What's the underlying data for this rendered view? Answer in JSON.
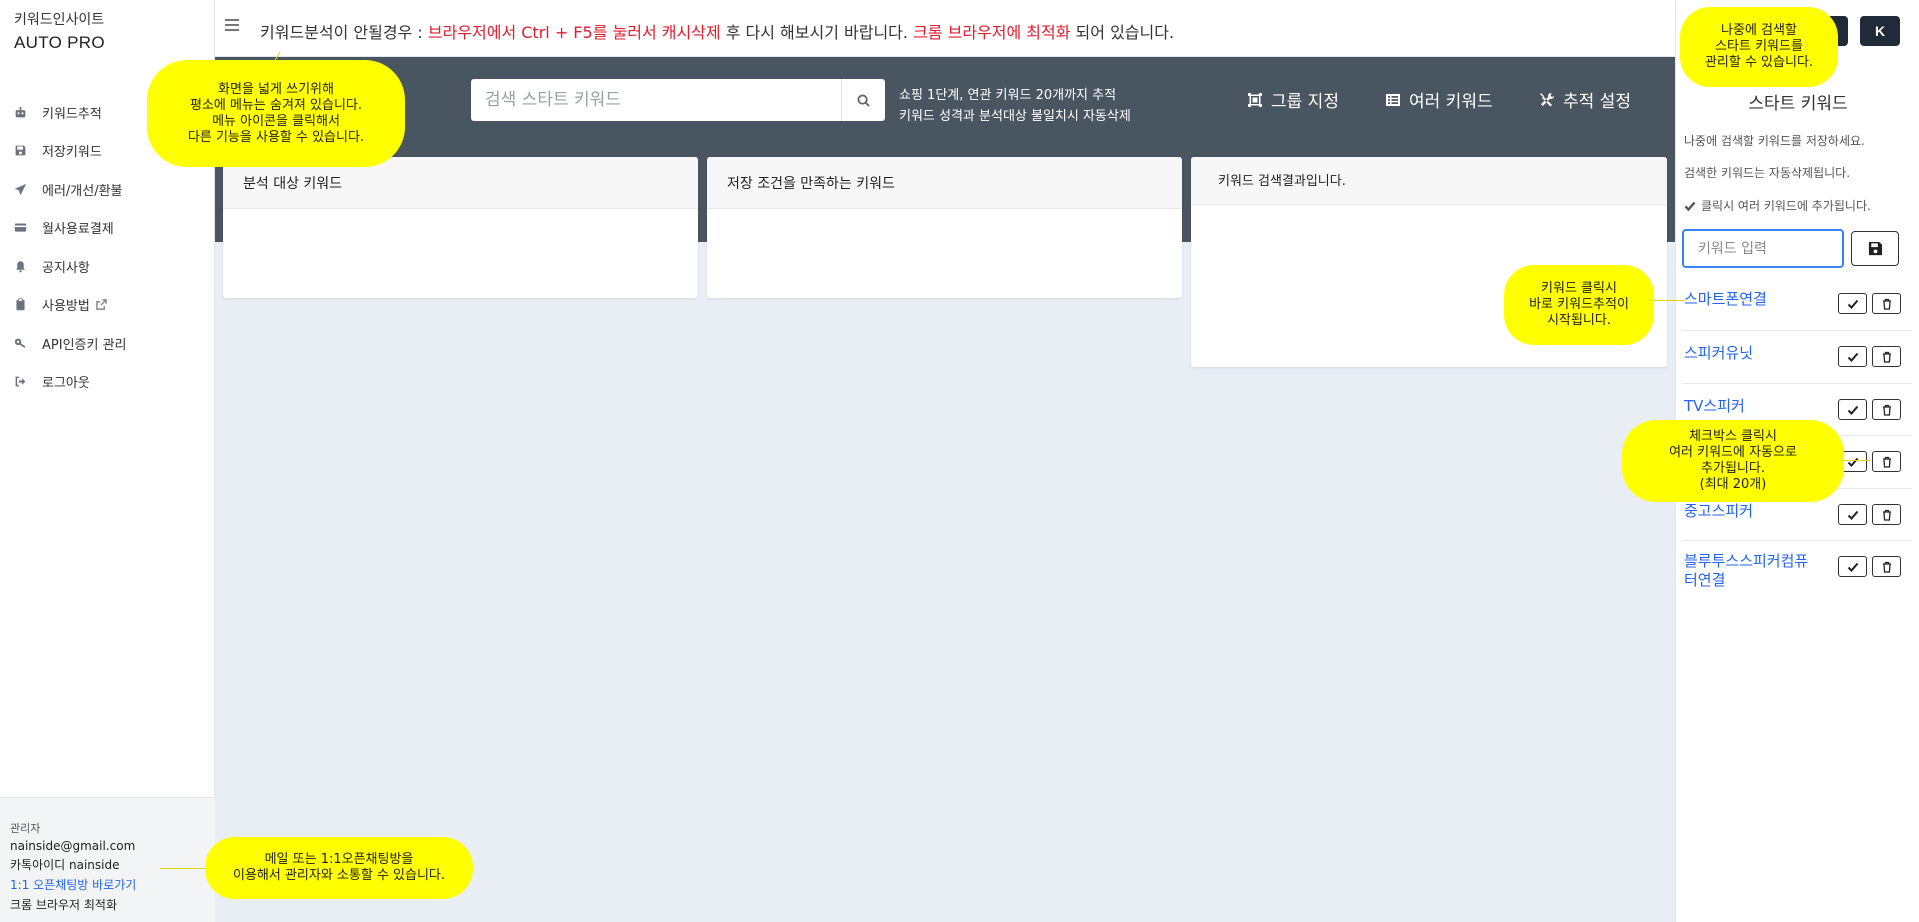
{
  "sidebar": {
    "brand_sub": "키워드인사이트",
    "brand_main": "AUTO PRO",
    "items": [
      {
        "label": "키워드추적",
        "icon": "robot-icon"
      },
      {
        "label": "저장키워드",
        "icon": "floppy-icon"
      },
      {
        "label": "에러/개선/환불",
        "icon": "paper-plane-icon"
      },
      {
        "label": "월사용료결제",
        "icon": "credit-card-icon"
      },
      {
        "label": "공지사항",
        "icon": "bell-icon"
      },
      {
        "label": "사용방법",
        "icon": "clipboard-icon"
      },
      {
        "label": "API인증키 관리",
        "icon": "key-icon"
      },
      {
        "label": "로그아웃",
        "icon": "logout-icon"
      }
    ],
    "footer": {
      "role": "관리자",
      "email": "nainside@gmail.com",
      "kakao": "카톡아이디 nainside",
      "chat_link": "1:1 오픈채팅방 바로가기",
      "browser": "크롬 브라우저 최적화"
    }
  },
  "topbar": {
    "notice_1": "키워드분석이 안될경우 : ",
    "notice_red_1": "브라우저에서 Ctrl + F5를 눌러서 캐시삭제",
    "notice_2": " 후 다시 해보시기 바랍니다. ",
    "notice_red_2": "크롬 브라우저에 최적화",
    "notice_3": " 되어 있습니다."
  },
  "band": {
    "search_placeholder": "검색 스타트 키워드",
    "info_line_1": "쇼핑 1단계, 연관 키워드 20개까지 추적",
    "info_line_2": "키워드 성격과 분석대상 불일치시 자동삭제",
    "btn_group": "그룹 지정",
    "btn_multi": "여러 키워드",
    "btn_settings": "추적 설정"
  },
  "cards": {
    "analysis": "분석 대상 키워드",
    "saved_condition": "저장 조건을 만족하는 키워드",
    "search_result": "키워드 검색결과입니다."
  },
  "right_panel": {
    "btn_k": "K",
    "title": "스타트 키워드",
    "desc_1": "나중에 검색할 키워드를 저장하세요.",
    "desc_2": "검색한 키워드는 자동삭제됩니다.",
    "desc_3": "클릭시 여러 키워드에 추가됩니다.",
    "input_placeholder": "키워드 입력",
    "keywords": [
      {
        "label": "스마트폰연결"
      },
      {
        "label": "스피커유닛"
      },
      {
        "label": "TV스피커"
      },
      {
        "label": ""
      },
      {
        "label": "중고스피커"
      },
      {
        "label": "블루투스스피커컴퓨터연결"
      }
    ]
  },
  "callouts": {
    "menu": [
      "화면을 넓게 쓰기위해",
      "평소에 메뉴는 숨겨져 있습니다.",
      "메뉴 아이콘을 클릭해서",
      "다른 기능을 사용할 수 있습니다."
    ],
    "start_keyword": [
      "나중에 검색할",
      "스타트 키워드를",
      "관리할 수 있습니다."
    ],
    "keyword_click": [
      "키워드 클릭시",
      "바로 키워드추적이",
      "시작됩니다."
    ],
    "checkbox": [
      "체크박스 클릭시",
      "여러 키워드에 자동으로",
      "추가됩니다.",
      "(최대 20개)"
    ],
    "contact": [
      "메일 또는 1:1오픈채팅방을",
      "이용해서 관리자와 소통할 수 있습니다."
    ]
  },
  "colors": {
    "band": "#4a5562",
    "callout": "#ffff00",
    "link": "#2563eb",
    "notice_red": "#e11d2f"
  }
}
